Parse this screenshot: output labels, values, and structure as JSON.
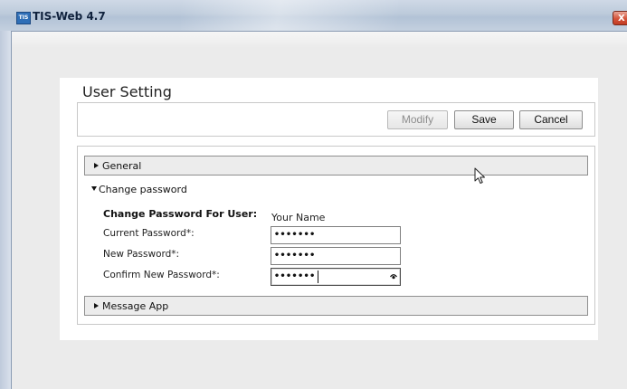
{
  "window": {
    "title": "TIS-Web 4.7",
    "icon_text": "TIS",
    "close_label": "X"
  },
  "page": {
    "title": "User Setting"
  },
  "toolbar": {
    "modify_label": "Modify",
    "save_label": "Save",
    "cancel_label": "Cancel"
  },
  "sections": {
    "general": {
      "label": "General",
      "expanded": false
    },
    "change_password": {
      "label": "Change password",
      "expanded": true
    },
    "message_app": {
      "label": "Message App",
      "expanded": false
    }
  },
  "change_password": {
    "heading": "Change Password For User:",
    "user_name": "Your Name",
    "current_label": "Current Password*:",
    "current_value": "•••••••",
    "new_label": "New Password*:",
    "new_value": "•••••••",
    "confirm_label": "Confirm New Password*:",
    "confirm_value": "•••••••"
  },
  "icons": {
    "app": "app-logo-icon",
    "close": "close-icon",
    "expand_collapsed": "triangle-right-icon",
    "expand_open": "triangle-down-icon",
    "reveal": "reveal-password-icon",
    "pointer": "mouse-cursor-icon"
  },
  "colors": {
    "titlebar": "#bccadb",
    "client_bg": "#ebebeb",
    "section_bar": "#ececec",
    "close_button": "#d4533a"
  }
}
